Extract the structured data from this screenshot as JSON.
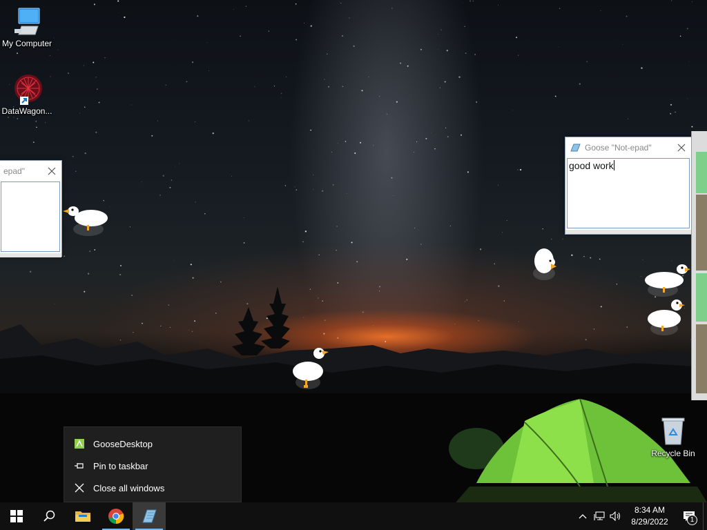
{
  "desktop": {
    "icons": [
      {
        "label": "My Computer",
        "icon": "computer-icon"
      },
      {
        "label": "DataWagon...",
        "icon": "datawagon-icon"
      },
      {
        "label": "Recycle Bin",
        "icon": "recycle-bin-icon"
      }
    ]
  },
  "windows": {
    "main_notepad": {
      "title": "Goose \"Not-epad\"",
      "content": "good work"
    },
    "left_notepad": {
      "title": "epad\""
    }
  },
  "jumplist": {
    "items": [
      {
        "label": "GooseDesktop",
        "icon": "goose-app-icon"
      },
      {
        "label": "Pin to taskbar",
        "icon": "pin-icon"
      },
      {
        "label": "Close all windows",
        "icon": "close-icon"
      }
    ]
  },
  "taskbar": {
    "buttons": [
      {
        "name": "start",
        "icon": "windows-logo-icon"
      },
      {
        "name": "search",
        "icon": "search-icon"
      },
      {
        "name": "file-explorer",
        "icon": "folder-icon"
      },
      {
        "name": "chrome",
        "icon": "chrome-icon"
      },
      {
        "name": "goose-notepad",
        "icon": "notepad-icon"
      }
    ],
    "tray": {
      "time": "8:34 AM",
      "date": "8/29/2022",
      "notification_count": "1",
      "icons": [
        "chevron-up-icon",
        "network-icon",
        "volume-icon",
        "notification-icon"
      ]
    }
  },
  "colors": {
    "taskbar_bg": "#101010",
    "accent": "#76b9ed",
    "jumplist_bg": "#1f1f1f"
  }
}
